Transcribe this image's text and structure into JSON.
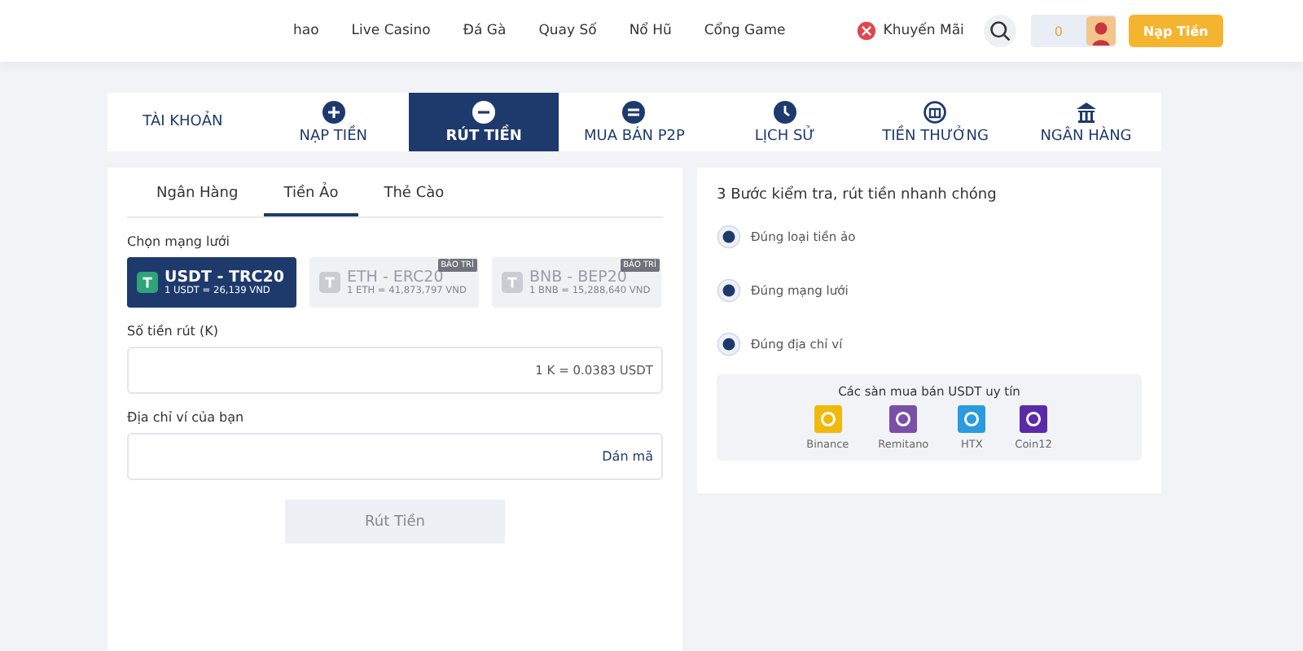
{
  "nav": {
    "items": [
      "hao",
      "Live Casino",
      "Đá Gà",
      "Quay Số",
      "Nổ Hũ",
      "Cổng Game"
    ],
    "promo": "Khuyến Mãi",
    "balance": "0",
    "deposit_button": "Nạp Tiền"
  },
  "tabs": [
    {
      "label": "TÀI KHOẢN",
      "selected": false
    },
    {
      "label": "NẠP TIỀN",
      "selected": false
    },
    {
      "label": "RÚT TIỀN",
      "selected": true
    },
    {
      "label": "MUA BÁN P2P",
      "selected": false
    },
    {
      "label": "LỊCH SỬ",
      "selected": false
    },
    {
      "label": "TIỀN THƯỞNG",
      "selected": false
    },
    {
      "label": "NGÂN HÀNG",
      "selected": false
    }
  ],
  "methods": [
    {
      "label": "Ngân Hàng",
      "selected": false
    },
    {
      "label": "Tiền Ảo",
      "selected": true
    },
    {
      "label": "Thẻ Cào",
      "selected": false
    }
  ],
  "network_label": "Chọn mạng lưới",
  "networks": [
    {
      "name": "USDT - TRC20",
      "rate": "1 USDT = 26,139 VND",
      "selected": true,
      "disabled": false
    },
    {
      "name": "ETH - ERC20",
      "rate": "1 ETH = 41,873,797 VND",
      "selected": false,
      "disabled": true,
      "badge": "BẢO TRÌ"
    },
    {
      "name": "BNB - BEP20",
      "rate": "1 BNB = 15,288,640 VND",
      "selected": false,
      "disabled": true,
      "badge": "BẢO TRÌ"
    }
  ],
  "amount": {
    "label": "Số tiền rút (K)",
    "hint": "1 K = 0.0383 USDT"
  },
  "address": {
    "label": "Địa chỉ ví của bạn",
    "action": "Dán mã"
  },
  "submit": "Rút Tiền",
  "steps": {
    "title": "3 Bước kiểm tra, rút tiền nhanh chóng",
    "items": [
      "Đúng loại tiền ảo",
      "Đúng mạng lưới",
      "Đúng địa chỉ ví"
    ]
  },
  "exchanges": {
    "title": "Các sàn mua bán USDT uy tín",
    "items": [
      {
        "name": "Binance",
        "color": "#f0b90b"
      },
      {
        "name": "Remitano",
        "color": "#7a4fa8"
      },
      {
        "name": "HTX",
        "color": "#2a9be0"
      },
      {
        "name": "Coin12",
        "color": "#5b2aa8"
      }
    ]
  }
}
